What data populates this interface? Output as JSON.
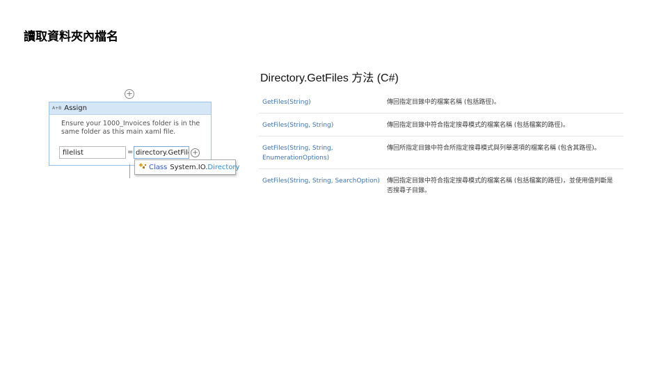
{
  "slide": {
    "title": "讀取資料夾內檔名"
  },
  "workflow": {
    "plus_symbol": "+",
    "assign": {
      "icon_text": "A+B",
      "title": "Assign",
      "annotation": "Ensure your 1000_Invoices folder is in the same folder as this main xaml file.",
      "to_value": "filelist",
      "equals": "=",
      "value_expr": "directory.GetFile"
    },
    "intellisense": {
      "icon": "class-icon",
      "keyword": "Class",
      "namespace": "System.IO.",
      "class_name": "Directory"
    }
  },
  "doc": {
    "title": "Directory.GetFiles 方法 (C#)",
    "rows": [
      {
        "method": "GetFiles(String)",
        "desc": "傳回指定目錄中的檔案名稱 (包括路徑)。"
      },
      {
        "method": "GetFiles(String, String)",
        "desc": "傳回指定目錄中符合指定搜尋模式的檔案名稱 (包括檔案的路徑)。"
      },
      {
        "method": "GetFiles(String, String, EnumerationOptions)",
        "desc": "傳回所指定目錄中符合所指定搜尋模式與列舉選項的檔案名稱 (包含其路徑)。"
      },
      {
        "method": "GetFiles(String, String, SearchOption)",
        "desc": "傳回指定目錄中符合指定搜尋模式的檔案名稱 (包括檔案的路徑)，並使用值判斷是否搜尋子目錄。"
      }
    ]
  },
  "colors": {
    "assign_header": "#d5e6f6",
    "assign_border": "#9cc3e7",
    "method_link": "#3c73b5",
    "class_blue": "#2b8fd9",
    "keyword_blue": "#2b58c9"
  }
}
